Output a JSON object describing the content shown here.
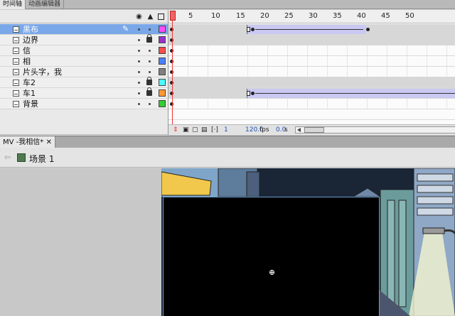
{
  "panel_tabs": [
    "时间轴",
    "动画编辑器"
  ],
  "header_icons": [
    "eye-icon",
    "lock-icon",
    "outline-icon"
  ],
  "ruler": [
    "1",
    "5",
    "10",
    "15",
    "20",
    "25",
    "30",
    "35",
    "40",
    "45",
    "50"
  ],
  "layers": [
    {
      "name": "黑布",
      "selected": true,
      "color": "#ff4cff",
      "locked": false
    },
    {
      "name": "边界",
      "selected": false,
      "color": "#9933cc",
      "locked": true
    },
    {
      "name": "信",
      "selected": false,
      "color": "#ff4c4c",
      "locked": false
    },
    {
      "name": "相",
      "selected": false,
      "color": "#4c7fff",
      "locked": false
    },
    {
      "name": "片头字，我",
      "selected": false,
      "color": "#808080",
      "locked": false
    },
    {
      "name": "车2",
      "selected": false,
      "color": "#4cffff",
      "locked": true
    },
    {
      "name": "车1",
      "selected": false,
      "color": "#ff9933",
      "locked": true
    },
    {
      "name": "背景",
      "selected": false,
      "color": "#33cc33",
      "locked": false
    }
  ],
  "timeline_footer": {
    "current_frame": "1",
    "fps": "120.0",
    "fps_unit": "fps",
    "time": "0.0",
    "time_unit": "s"
  },
  "document_tab": {
    "title": "MV -我相信*",
    "close": "✕"
  },
  "scene": {
    "label": "场景 1"
  },
  "colors": {
    "selected_row": "#7aa7e8",
    "tween": "#c9c9f2",
    "playhead": "#f06464"
  }
}
